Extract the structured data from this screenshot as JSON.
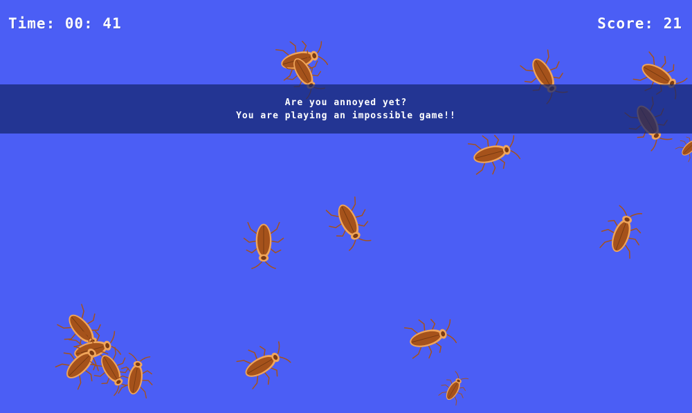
{
  "hud": {
    "time_text": "Time: 00: 41",
    "score_text": "Score: 21"
  },
  "banner": {
    "line1": "Are you annoyed yet?",
    "line2": "You are playing an impossible game!!"
  },
  "colors": {
    "background": "#4b5ef5",
    "banner": "#14266e",
    "roach_body": "#a5521b",
    "roach_edge": "#f0a55a",
    "roach_head": "#7a3a12"
  },
  "sprites": {
    "enemy_icon": "cockroach-icon"
  }
}
